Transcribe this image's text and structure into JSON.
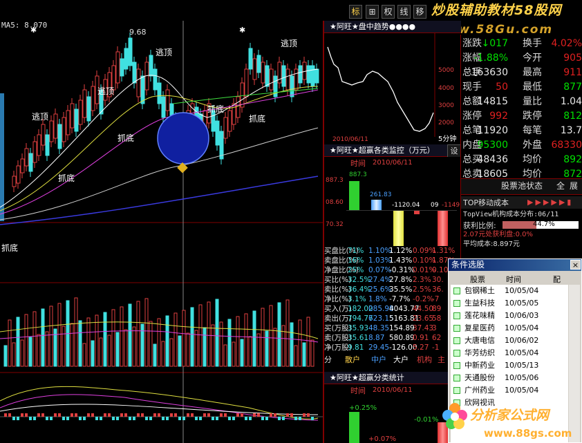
{
  "toolbar": {
    "buttons": [
      "标",
      "⊞",
      "权",
      "线",
      "移"
    ],
    "ma_label": "MA5: 8.070",
    "watermark_top": "炒股辅助教材58股网",
    "watermark_top_url": "www.58Gu.com"
  },
  "kline": {
    "price_high_label": "9.68",
    "annotations": [
      "逃顶",
      "逃顶",
      "逃顶",
      "逃顶",
      "抓底",
      "抓底",
      "抓底",
      "抓底"
    ],
    "bottom_left_label": "抓底"
  },
  "intraday": {
    "title": "★阿旺★盘中趋势●●●●",
    "right_scale": [
      "5000",
      "4000",
      "3000",
      "2000",
      "1000"
    ],
    "date_label": "2010/06/11",
    "period_label": "5分钟"
  },
  "monitor": {
    "title": "★阿旺★超赢各类监控（万元）",
    "settings_label": "设",
    "time_label": "时间",
    "date_label": "2010/06/11",
    "scale": [
      "887.3",
      "08.60",
      "70.32"
    ],
    "bar_values": [
      "887.3",
      "261.83",
      "-1120.04",
      "-1149"
    ],
    "extra_bar_label": "09",
    "rows": [
      {
        "label": "买盘比(%)",
        "vals": [
          "71%",
          "1.10%",
          "1.12%",
          "0.09%",
          "1.31%"
        ]
      },
      {
        "label": "卖盘比(%)",
        "vals": [
          "16%",
          "1.03%",
          "1.43%",
          "0.10%",
          "1.87%"
        ]
      },
      {
        "label": "净盘比(%)",
        "vals": [
          "25%",
          "0.07%",
          "-0.31%",
          "0.01%",
          "0.10%"
        ]
      },
      {
        "label": "买比(%)",
        "vals": [
          "32.5%",
          "27.4%",
          "27.8%",
          "2.3%",
          "30."
        ]
      },
      {
        "label": "卖比(%)",
        "vals": [
          "36.4%",
          "25.6%",
          "35.5%",
          "2.5%",
          "36."
        ]
      },
      {
        "label": "净比(%)",
        "vals": [
          "3.1%",
          "1.8%",
          "-7.7%",
          "-0.2%",
          "-7"
        ]
      },
      {
        "label": "买入(万)",
        "vals": [
          "182.02",
          "085.98",
          "4043.77",
          "44.50",
          "89"
        ]
      },
      {
        "label": "卖出(万)",
        "vals": [
          "794.77",
          "623.15",
          "5163.81",
          "23.65",
          "58"
        ]
      },
      {
        "label": "买(万股)",
        "vals": [
          "35.93",
          "48.35",
          "154.89",
          "37.43",
          "3"
        ]
      },
      {
        "label": "卖(万股)",
        "vals": [
          "35.61",
          "8.87",
          "580.89",
          "0.91",
          "62"
        ]
      },
      {
        "label": "净(万股)",
        "vals": [
          "9.81",
          "29.45",
          "-126.00",
          "5.27",
          "-1"
        ]
      }
    ],
    "categories": [
      "分",
      "散户",
      "中户",
      "大户",
      "机构",
      "主"
    ]
  },
  "stats": {
    "title": "★阿旺★超赢分类统计",
    "time_label": "时间",
    "date_label": "2010/06/11",
    "v1": "+0.25%",
    "v2": "-0.01%",
    "v3": "+0.07%"
  },
  "quote": {
    "rows": [
      {
        "l1": "涨跌",
        "v1": "↓017",
        "l2": "换手",
        "v2": "4.02%",
        "c1": "#00e000",
        "c2": "#e02020"
      },
      {
        "l1": "涨幅",
        "v1": "-1.88%",
        "l2": "今开",
        "v2": "905",
        "c1": "#00e000",
        "c2": "#e02020"
      },
      {
        "l1": "总手",
        "v1": "163630",
        "l2": "最高",
        "v2": "911",
        "c1": "#e8e8e8",
        "c2": "#e02020"
      },
      {
        "l1": "现手",
        "v1": "50",
        "l2": "最低",
        "v2": "877",
        "c1": "#e02020",
        "c2": "#00e000"
      },
      {
        "l1": "总额",
        "v1": "14815",
        "l2": "量比",
        "v2": "1.04",
        "c1": "#e8e8e8",
        "c2": "#e8e8e8"
      },
      {
        "l1": "涨停",
        "v1": "992",
        "l2": "跌停",
        "v2": "812",
        "c1": "#e02020",
        "c2": "#00e000"
      },
      {
        "l1": "总笔",
        "v1": "11920",
        "l2": "每笔",
        "v2": "13.7",
        "c1": "#e8e8e8",
        "c2": "#e8e8e8"
      },
      {
        "l1": "内盘",
        "v1": "95300",
        "l2": "外盘",
        "v2": "68330",
        "c1": "#00e000",
        "c2": "#e02020"
      },
      {
        "l1": "总买",
        "v1": "48436",
        "l2": "均价",
        "v2": "892",
        "c1": "#e8e8e8",
        "c2": "#00e000"
      },
      {
        "l1": "总卖",
        "v1": "18605",
        "l2": "均价",
        "v2": "872",
        "c1": "#e8e8e8",
        "c2": "#00e000"
      }
    ],
    "tab_label": "股票池状态",
    "btn_all": "全",
    "btn_expand": "展"
  },
  "cost": {
    "title": "TOP移动成本",
    "dist_label": "TopView机构成本分布:06/11",
    "profit_label": "获利比例:",
    "profit_value": "44.7%",
    "profit_ratio": 0.447,
    "line1": "2.07元处获利盘:0.0%",
    "line2": "平均成本:8.897元"
  },
  "dialog": {
    "title": "条件选股",
    "close": "×",
    "columns": [
      "股票",
      "时间",
      "配"
    ],
    "rows": [
      {
        "name": "包钢稀土",
        "time": "10/05/04"
      },
      {
        "name": "生益科技",
        "time": "10/05/05"
      },
      {
        "name": "莲花味精",
        "time": "10/06/03"
      },
      {
        "name": "复星医药",
        "time": "10/05/04"
      },
      {
        "name": "大唐电信",
        "time": "10/06/02"
      },
      {
        "name": "华芳纺织",
        "time": "10/05/04"
      },
      {
        "name": "中新药业",
        "time": "10/05/13"
      },
      {
        "name": "天通股份",
        "time": "10/05/06"
      },
      {
        "name": "广州药业",
        "time": "10/05/04"
      },
      {
        "name": "欣网视讯",
        "time": ""
      }
    ]
  },
  "watermark_bottom": {
    "title": "分析家公式网",
    "url": "www.88gs.com"
  },
  "colors": {
    "up": "#e02020",
    "down": "#40e0e0",
    "border": "#800000",
    "bg": "#000000"
  }
}
